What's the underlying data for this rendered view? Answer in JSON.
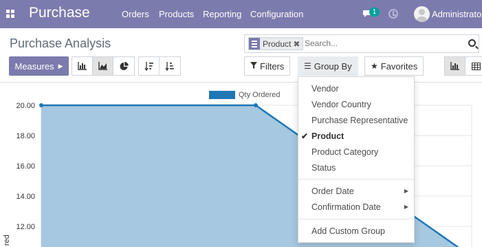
{
  "navbar": {
    "brand": "Purchase",
    "menus": [
      "Orders",
      "Products",
      "Reporting",
      "Configuration"
    ],
    "notification_count": "1",
    "user_name": "Administrator",
    "color": "#7c7bad"
  },
  "breadcrumb": "Purchase Analysis",
  "search": {
    "facet_label": "Product",
    "placeholder": "Search..."
  },
  "toolbar": {
    "measures_label": "Measures",
    "filters_label": "Filters",
    "group_by_label": "Group By",
    "favorites_label": "Favorites",
    "chart_types": [
      "bar-chart-icon",
      "line-chart-icon",
      "pie-chart-icon"
    ],
    "active_chart_type": "line-chart-icon",
    "sort_buttons": [
      "sort-descending-icon",
      "sort-ascending-icon"
    ],
    "view_switchers": [
      "graph-view-icon",
      "pivot-view-icon"
    ],
    "active_view": "graph-view-icon"
  },
  "group_by_menu": {
    "section1": [
      "Vendor",
      "Vendor Country",
      "Purchase Representative",
      "Product",
      "Product Category",
      "Status"
    ],
    "selected": "Product",
    "section2": [
      "Order Date",
      "Confirmation Date"
    ],
    "section3": [
      "Add Custom Group"
    ]
  },
  "chart_data": {
    "type": "area",
    "series": [
      {
        "name": "Qty Ordered",
        "values": [
          20,
          20,
          10.5
        ]
      }
    ],
    "yticks": [
      "20.00",
      "18.00",
      "16.00",
      "14.00",
      "12.00"
    ],
    "ylabel_partial": "red",
    "ylim": [
      10,
      20
    ],
    "legend_position": "top-center",
    "color": "#1f77b4",
    "fill": "#a6c8e0",
    "grid": true
  }
}
